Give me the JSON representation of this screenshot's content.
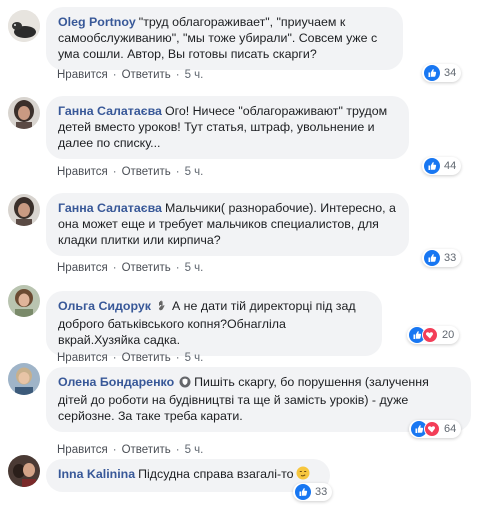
{
  "comments": [
    {
      "author": "Oleg Portnoy",
      "text": "\"труд облагораживает\", \"приучаем к самообслуживанию\", \"мы тоже убирали\". Совсем уже с ума сошли. Автор, Вы готовы писать скарги?",
      "like_label": "Нравится",
      "reply_label": "Ответить",
      "time": "5 ч.",
      "reactions_count": "34",
      "reactions": [
        "like"
      ]
    },
    {
      "author": "Ганна Салатаєва",
      "text": "Ого! Ничесе \"облагораживают\" трудом детей вместо уроков! Тут статья, штраф, увольнение и далее по списку...",
      "like_label": "Нравится",
      "reply_label": "Ответить",
      "time": "5 ч.",
      "reactions_count": "44",
      "reactions": [
        "like"
      ]
    },
    {
      "author": "Ганна Салатаєва",
      "text": "Мальчики( разнорабочие). Интересно, а она может еще и требует мальчиков специалистов, для кладки плитки или кирпича?",
      "like_label": "Нравится",
      "reply_label": "Ответить",
      "time": "5 ч.",
      "reactions_count": "33",
      "reactions": [
        "like"
      ]
    },
    {
      "author": "Ольга Сидорук",
      "text": "А не дати тій директорці під зад доброго батьківського копня?Обнагліла вкрай.Хузяйка садка.",
      "like_label": "Нравится",
      "reply_label": "Ответить",
      "time": "5 ч.",
      "reactions_count": "20",
      "reactions": [
        "like",
        "love"
      ]
    },
    {
      "author": "Олена Бондаренко",
      "text": "Пишіть скаргу, бо порушення (залучення дітей до роботи на будівництві та ще й замість уроків) - дуже серйозне. За таке треба карати.",
      "like_label": "Нравится",
      "reply_label": "Ответить",
      "time": "5 ч.",
      "reactions_count": "64",
      "reactions": [
        "like",
        "love"
      ]
    },
    {
      "author": "Inna Kalinina",
      "text": "Підсудна справа взагалі-то",
      "reactions_count": "33",
      "reactions": [
        "like"
      ]
    }
  ],
  "colors": {
    "author": "#385898",
    "bubble": "#f2f3f5",
    "like": "#1877f2",
    "love": "#f33e58"
  }
}
